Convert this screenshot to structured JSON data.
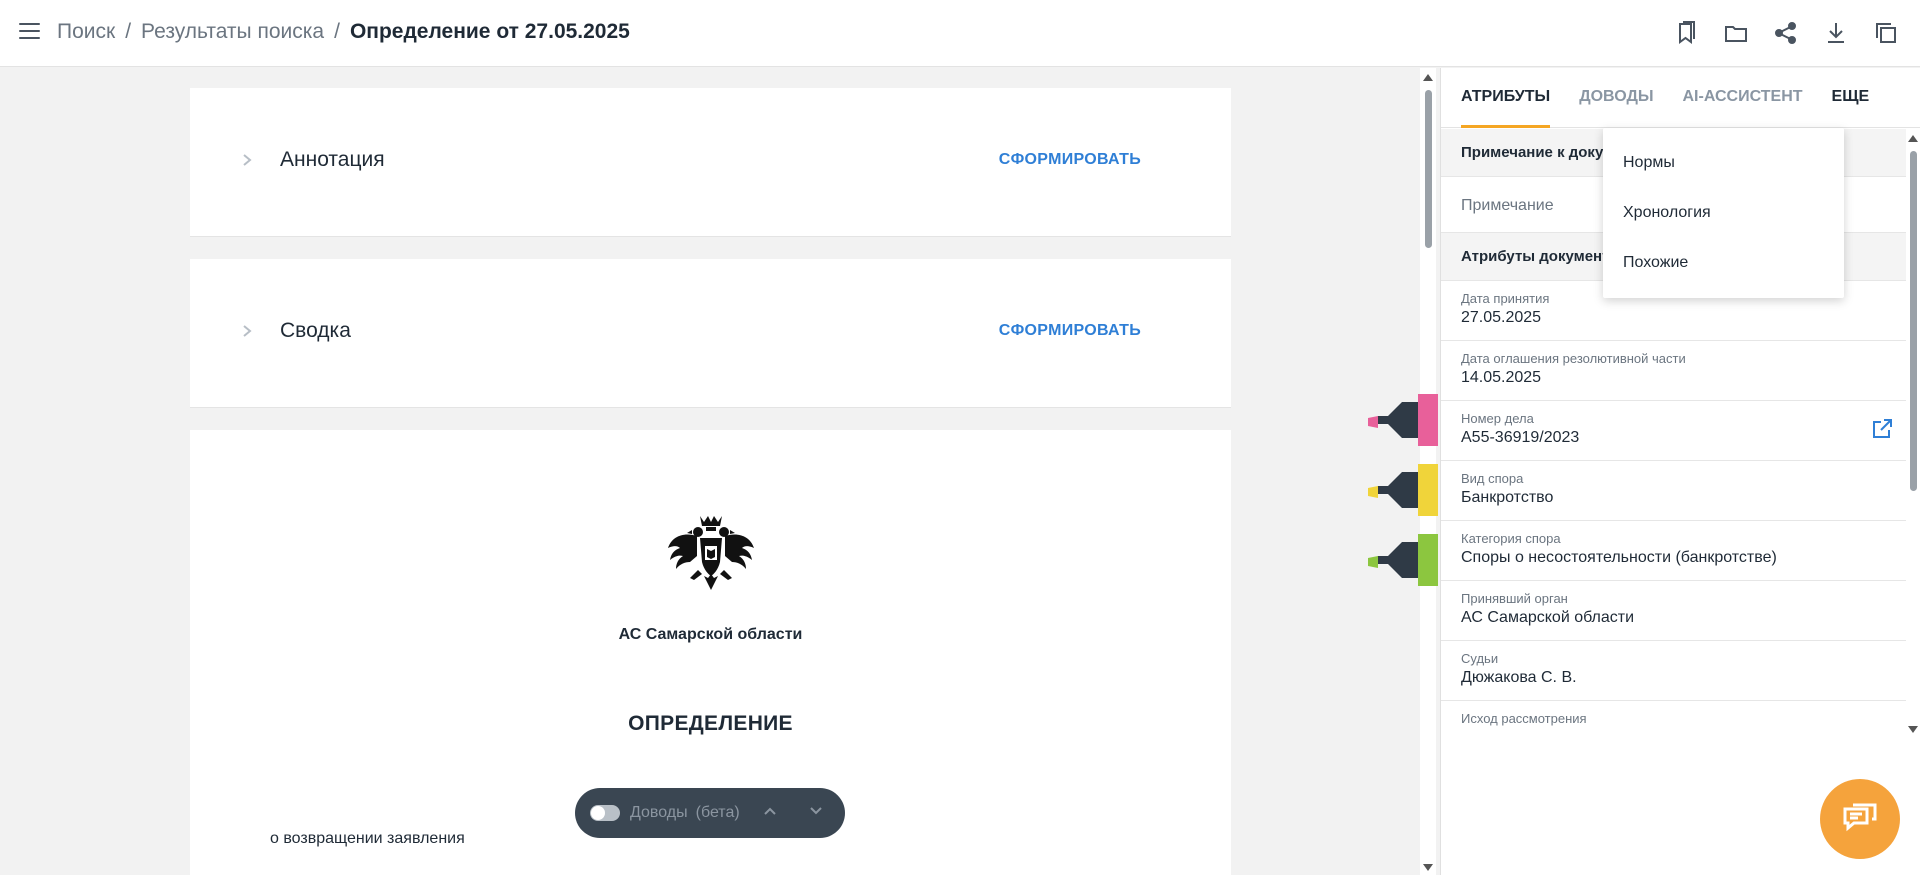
{
  "header": {
    "breadcrumb": {
      "search": "Поиск",
      "sep1": "/",
      "results": "Результаты поиска",
      "sep2": "/",
      "current": "Определение от 27.05.2025"
    },
    "actions": [
      "bookmark-icon",
      "folder-icon",
      "share-icon",
      "download-icon",
      "copy-icon"
    ]
  },
  "document": {
    "annotation": {
      "title": "Аннотация",
      "button": "СФОРМИРОВАТЬ"
    },
    "summary": {
      "title": "Сводка",
      "button": "СФОРМИРОВАТЬ"
    },
    "court_name": "АС Самарской области",
    "doc_type": "ОПРЕДЕЛЕНИЕ",
    "subject": "о возвращении заявления"
  },
  "args_bar": {
    "label": "Доводы",
    "beta": "(бета)",
    "enabled": false
  },
  "markers": [
    {
      "name": "pink",
      "color": "#e8609a"
    },
    {
      "name": "yellow",
      "color": "#f0d43a"
    },
    {
      "name": "green",
      "color": "#8cc63f"
    }
  ],
  "panel": {
    "tabs": [
      {
        "label": "АТРИБУТЫ",
        "active": true
      },
      {
        "label": "ДОВОДЫ",
        "active": false
      },
      {
        "label": "AI-АССИСТЕНТ",
        "active": false
      },
      {
        "label": "ЕЩЕ",
        "active": false
      }
    ],
    "note_group_title": "Примечание к документу",
    "note_placeholder": "Примечание",
    "attr_group_title": "Атрибуты документа",
    "attributes": [
      {
        "label": "Дата принятия",
        "value": "27.05.2025"
      },
      {
        "label": "Дата оглашения резолютивной части",
        "value": "14.05.2025"
      },
      {
        "label": "Номер дела",
        "value": "А55-36919/2023"
      },
      {
        "label": "Вид спора",
        "value": "Банкротство"
      },
      {
        "label": "Категория спора",
        "value": "Споры о несостоятельности (банкротстве)"
      },
      {
        "label": "Принявший орган",
        "value": "АС Самарской области"
      },
      {
        "label": "Судьи",
        "value": "Дюжакова С. В."
      },
      {
        "label": "Исход рассмотрения",
        "value": ""
      }
    ]
  },
  "dropdown": {
    "items": [
      "Нормы",
      "Хронология",
      "Похожие"
    ]
  },
  "colors": {
    "accent": "#f5a623",
    "link": "#2f7fd6",
    "fab": "#f5a33c"
  }
}
